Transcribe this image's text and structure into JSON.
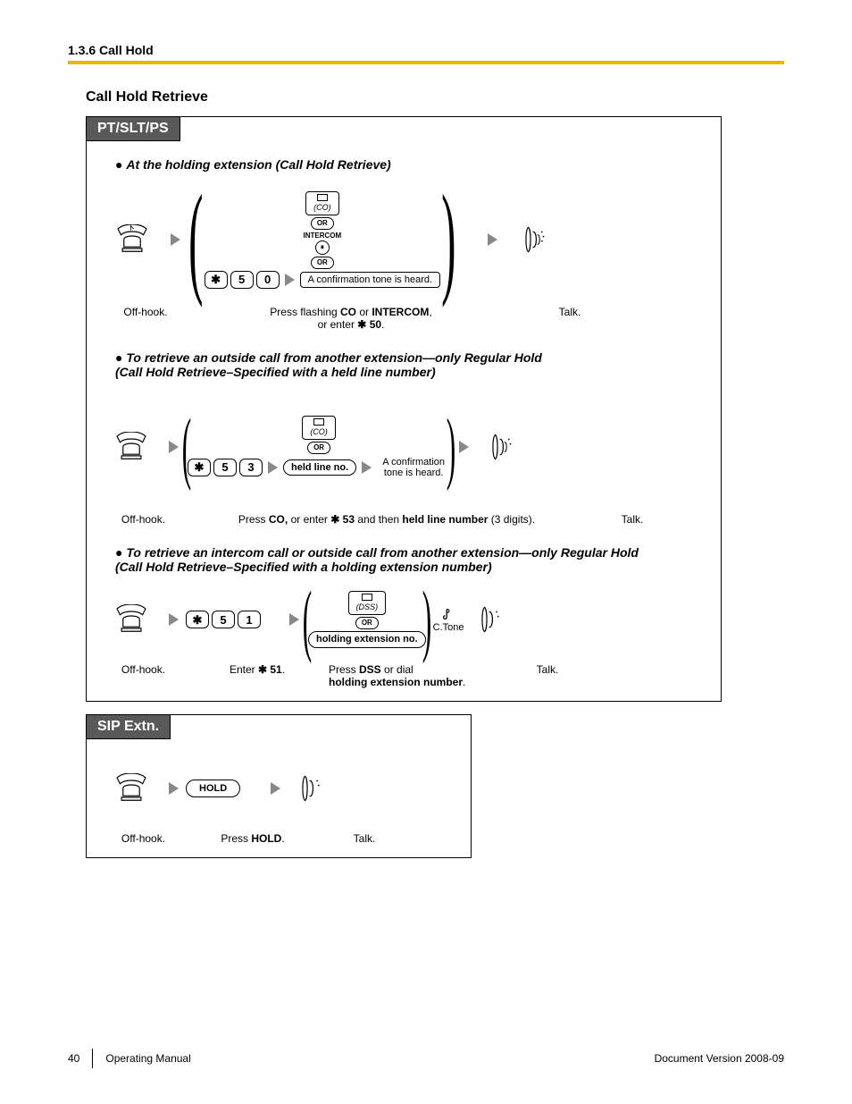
{
  "header": {
    "crumb": "1.3.6 Call Hold"
  },
  "section": {
    "title": "Call Hold Retrieve"
  },
  "panel1": {
    "tab": "PT/SLT/PS",
    "block1": {
      "title": "At the holding extension (Call Hold Retrieve)",
      "offhook": "Off-hook.",
      "co": "(CO)",
      "or": "OR",
      "intercom": "INTERCOM",
      "keys": [
        "5",
        "0"
      ],
      "conf": "A confirmation tone is heard.",
      "cap_mid1": "Press flashing ",
      "cap_mid2": "CO",
      "cap_mid3": " or ",
      "cap_mid4": "INTERCOM",
      "cap_mid5": ",",
      "cap_mid6": "or enter ",
      "cap_mid7": " 50",
      "talk": "Talk."
    },
    "block2": {
      "title_a": "To retrieve an outside call from another extension—only Regular Hold",
      "title_b": "(Call Hold Retrieve–Specified with a held line number)",
      "offhook": "Off-hook.",
      "keys": [
        "5",
        "3"
      ],
      "co": "(CO)",
      "or": "OR",
      "heldline": "held line no.",
      "conf": "A confirmation tone is heard.",
      "cap1": "Press ",
      "cap2": "CO,",
      "cap3": " or enter ",
      "cap4": " 53",
      "cap5": " and then ",
      "cap6": "held line number",
      "cap7": " (3 digits).",
      "talk": "Talk."
    },
    "block3": {
      "title_a": "To retrieve an intercom call or outside call from another extension—only Regular Hold",
      "title_b": "(Call Hold Retrieve–Specified with a holding extension number)",
      "offhook": "Off-hook.",
      "keys": [
        "5",
        "1"
      ],
      "dss": "(DSS)",
      "or": "OR",
      "holdext": "holding extension no.",
      "ctone": "C.Tone",
      "cap_enter1": "Enter ",
      "cap_enter2": " 51",
      "cap_dss1": "Press ",
      "cap_dss2": "DSS",
      "cap_dss3": " or dial ",
      "cap_dss4": "holding extension number",
      "talk": "Talk."
    }
  },
  "panel2": {
    "tab": "SIP Extn.",
    "offhook": "Off-hook.",
    "hold": "HOLD",
    "cap_hold1": "Press ",
    "cap_hold2": "HOLD",
    "talk": "Talk."
  },
  "footer": {
    "page": "40",
    "left": "Operating Manual",
    "right": "Document Version  2008-09"
  },
  "glyphs": {
    "star": "✱",
    "dot": "."
  }
}
